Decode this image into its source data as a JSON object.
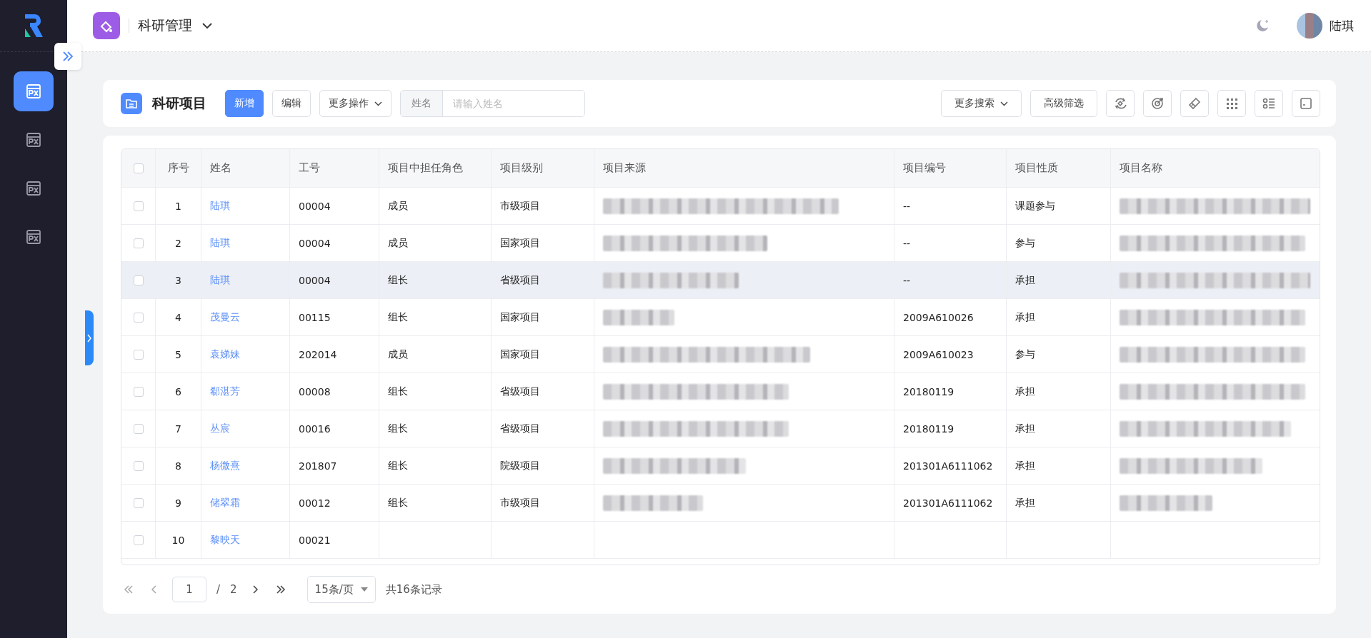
{
  "sidebar": {
    "items": [
      {
        "selected": true
      },
      {
        "selected": false
      },
      {
        "selected": false
      },
      {
        "selected": false
      }
    ]
  },
  "header": {
    "app_title": "科研管理",
    "user_name": "陆琪"
  },
  "toolbar": {
    "title": "科研项目",
    "buttons": [
      {
        "label": "新增",
        "kind": "primary"
      },
      {
        "label": "编辑",
        "kind": "default"
      },
      {
        "label": "更多操作",
        "kind": "dropdown"
      }
    ],
    "search": {
      "label": "姓名",
      "placeholder": "请输入姓名"
    },
    "right_buttons": [
      {
        "label": "更多搜索",
        "kind": "dropdown"
      },
      {
        "label": "高级筛选",
        "kind": "default"
      }
    ]
  },
  "table": {
    "all_checked": false,
    "columns": [
      "序号",
      "姓名",
      "工号",
      "项目中担任角色",
      "项目级别",
      "项目来源",
      "项目编号",
      "项目性质",
      "项目名称"
    ],
    "rows": [
      {
        "index": "1",
        "name": "陆琪",
        "staff_id": "00004",
        "role": "成员",
        "level": "市级项目",
        "number": "--",
        "nature": "课题参与",
        "checked": false,
        "highlighted": false
      },
      {
        "index": "2",
        "name": "陆琪",
        "staff_id": "00004",
        "role": "成员",
        "level": "国家项目",
        "number": "--",
        "nature": "参与",
        "checked": false,
        "highlighted": false
      },
      {
        "index": "3",
        "name": "陆琪",
        "staff_id": "00004",
        "role": "组长",
        "level": "省级项目",
        "number": "--",
        "nature": "承担",
        "checked": false,
        "highlighted": true
      },
      {
        "index": "4",
        "name": "茂曼云",
        "staff_id": "00115",
        "role": "组长",
        "level": "国家项目",
        "number": "2009A610026",
        "nature": "承担",
        "checked": false,
        "highlighted": false
      },
      {
        "index": "5",
        "name": "袁娣妹",
        "staff_id": "202014",
        "role": "成员",
        "level": "国家项目",
        "number": "2009A610023",
        "nature": "参与",
        "checked": false,
        "highlighted": false
      },
      {
        "index": "6",
        "name": "郗湛芳",
        "staff_id": "00008",
        "role": "组长",
        "level": "省级项目",
        "number": "20180119",
        "nature": "承担",
        "checked": false,
        "highlighted": false
      },
      {
        "index": "7",
        "name": "丛宸",
        "staff_id": "00016",
        "role": "组长",
        "level": "省级项目",
        "number": "20180119",
        "nature": "承担",
        "checked": false,
        "highlighted": false
      },
      {
        "index": "8",
        "name": "杨微熹",
        "staff_id": "201807",
        "role": "组长",
        "level": "院级项目",
        "number": "201301A6111062",
        "nature": "承担",
        "checked": false,
        "highlighted": false
      },
      {
        "index": "9",
        "name": "储翠霜",
        "staff_id": "00012",
        "role": "组长",
        "level": "市级项目",
        "number": "201301A6111062",
        "nature": "承担",
        "checked": false,
        "highlighted": false
      },
      {
        "index": "10",
        "name": "黎映天",
        "staff_id": "00021",
        "checked": false,
        "highlighted": false
      }
    ]
  },
  "pagination": {
    "page": "1",
    "separator": "/",
    "total_pages": "2",
    "page_size": "15条/页",
    "summary": "共16条记录"
  }
}
